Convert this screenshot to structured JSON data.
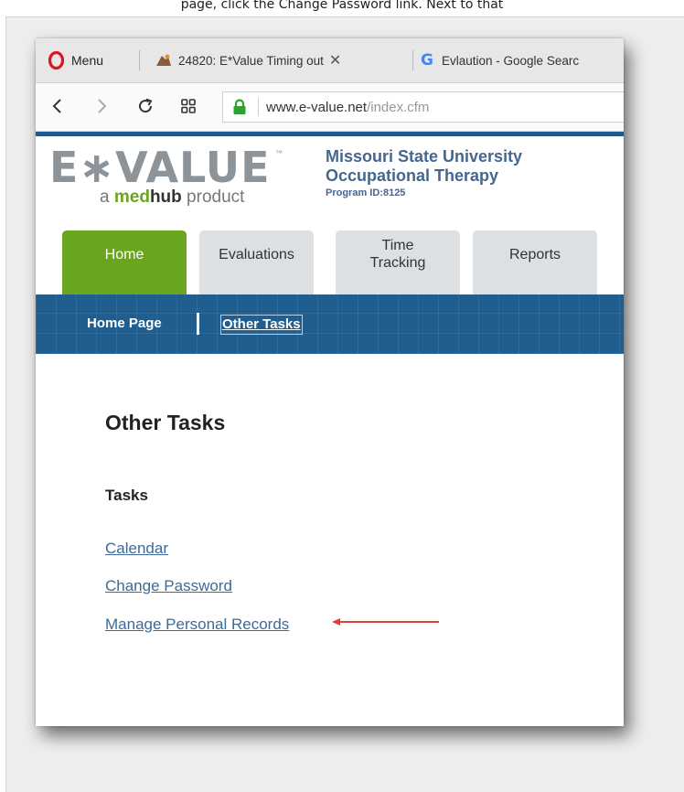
{
  "caption": "page, click the Change Password link. Next to that",
  "browser": {
    "menu_label": "Menu",
    "tabs": [
      {
        "title": "24820: E*Value Timing out",
        "icon": "site-favicon"
      },
      {
        "title": "Evlaution - Google Searc",
        "icon": "google-icon"
      }
    ],
    "url_domain": "www.e-value.net",
    "url_path": "/index.cfm"
  },
  "site": {
    "logo_text": "E∗VALUE",
    "logo_tm": "™",
    "logo_sub_prefix": "a ",
    "logo_sub_med": "med",
    "logo_sub_hub": "hub",
    "logo_sub_suffix": " product",
    "org_line1": "Missouri State University",
    "org_line2": "Occupational Therapy",
    "program_id": "Program ID:8125",
    "nav_tabs": [
      {
        "label": "Home",
        "active": true
      },
      {
        "label": "Evaluations",
        "active": false
      },
      {
        "label": "Time Tracking",
        "active": false
      },
      {
        "label": "Reports",
        "active": false
      }
    ],
    "subnav": {
      "home": "Home Page",
      "current": "Other Tasks"
    }
  },
  "content": {
    "page_title": "Other Tasks",
    "section_title": "Tasks",
    "links": [
      "Calendar",
      "Change Password",
      "Manage Personal Records"
    ]
  },
  "colors": {
    "active_tab": "#6aa51e",
    "subnav_bg": "#1f5e8f",
    "link": "#3d6a99",
    "annotation_arrow": "#e0403c"
  }
}
